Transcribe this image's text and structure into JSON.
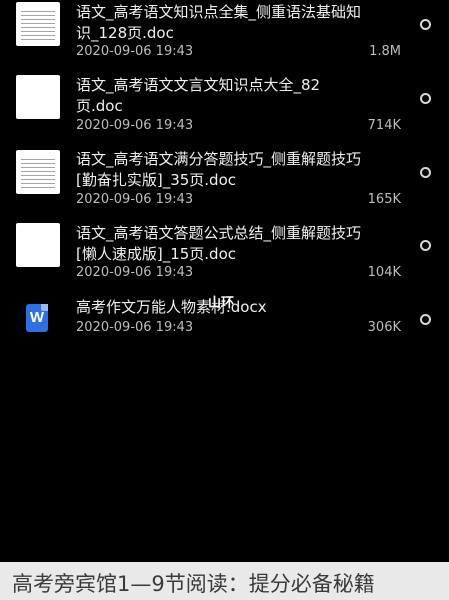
{
  "files": [
    {
      "title": "语文_高考语文知识点全集_侧重语法基础知识_128页.doc",
      "date": "2020-09-06 19:43",
      "size": "1.8M",
      "icon": "doc-thumbnail-icon"
    },
    {
      "title": "语文_高考语文文言文知识点大全_82页.doc",
      "date": "2020-09-06 19:43",
      "size": "714K",
      "icon": "doc-thumbnail-icon"
    },
    {
      "title": "语文_高考语文满分答题技巧_侧重解题技巧[勤奋扎实版]_35页.doc",
      "date": "2020-09-06 19:43",
      "size": "165K",
      "icon": "doc-thumbnail-icon"
    },
    {
      "title": "语文_高考语文答题公式总结_侧重解题技巧[懒人速成版]_15页.doc",
      "date": "2020-09-06 19:43",
      "size": "104K",
      "icon": "doc-thumbnail-icon"
    },
    {
      "title": "高考作文万能人物素材.docx",
      "date": "2020-09-06 19:43",
      "size": "306K",
      "icon": "word-file-icon",
      "icon_letter": "W"
    }
  ],
  "overlay_text": "山环",
  "caption": "高考旁宾馆1—9节阅读：提分必备秘籍",
  "colors": {
    "background": "#000000",
    "word_blue": "#2f6fe4",
    "caption_bar": "#e9e9e9"
  }
}
